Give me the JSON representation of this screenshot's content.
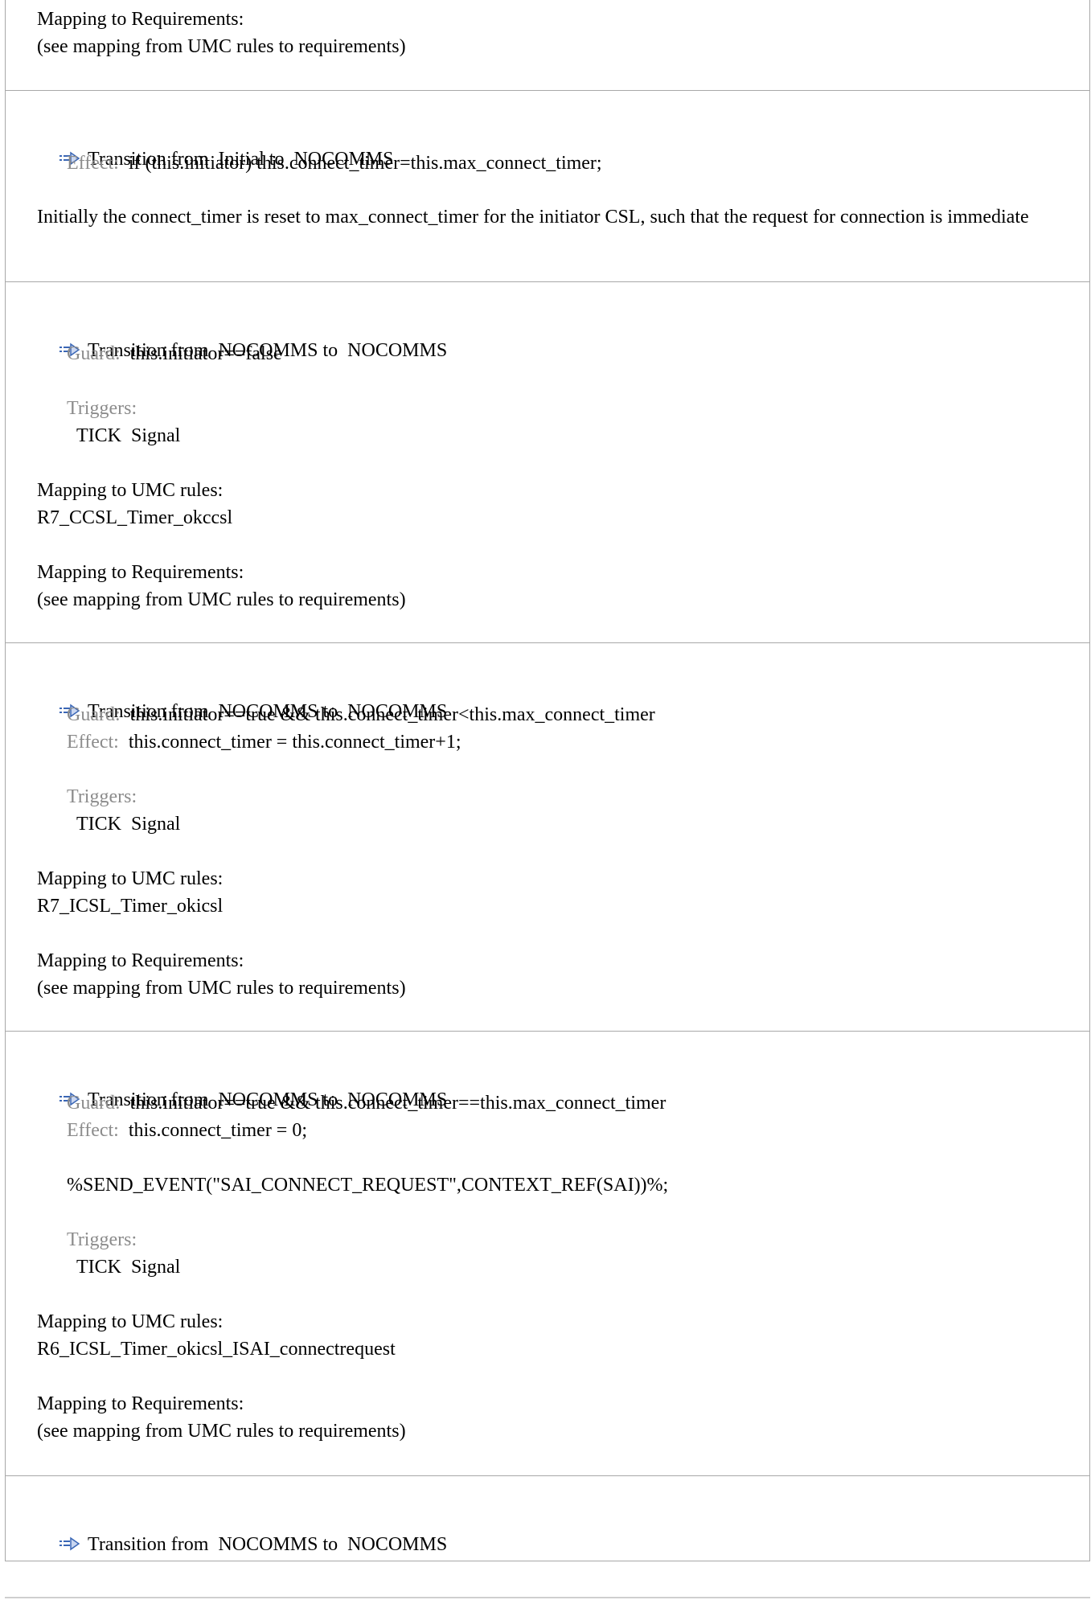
{
  "sections": [
    {
      "mapping_req_label": "Mapping to Requirements:",
      "mapping_req_value": "(see mapping from UMC rules to requirements)"
    },
    {
      "title": "Transition from  Initial to  NOCOMMS",
      "effect_label": "Effect:",
      "effect_value": "if (this.initiator) this.connect_timer=this.max_connect_timer;",
      "description": "Initially the connect_timer is reset to max_connect_timer for the initiator CSL, such that the request for connection is immediate"
    },
    {
      "title": "Transition from  NOCOMMS to  NOCOMMS",
      "guard_label": "Guard:",
      "guard_value": "this.initiator==false",
      "triggers_label": "Triggers:",
      "trigger_value": "TICK  Signal",
      "mapping_umc_label": "Mapping to UMC rules:",
      "mapping_umc_value": "R7_CCSL_Timer_okccsl",
      "mapping_req_label": "Mapping to Requirements:",
      "mapping_req_value": "(see mapping from UMC rules to requirements)"
    },
    {
      "title": "Transition from  NOCOMMS to  NOCOMMS",
      "guard_label": "Guard:",
      "guard_value": "this.initiator==true && this.connect_timer<this.max_connect_timer",
      "effect_label": "Effect:",
      "effect_value": "this.connect_timer = this.connect_timer+1;",
      "triggers_label": "Triggers:",
      "trigger_value": "TICK  Signal",
      "mapping_umc_label": "Mapping to UMC rules:",
      "mapping_umc_value": "R7_ICSL_Timer_okicsl",
      "mapping_req_label": "Mapping to Requirements:",
      "mapping_req_value": "(see mapping from UMC rules to requirements)"
    },
    {
      "title": "Transition from  NOCOMMS to  NOCOMMS",
      "guard_label": "Guard:",
      "guard_value": "this.initiator==true && this.connect_timer==this.max_connect_timer",
      "effect_label": "Effect:",
      "effect_value": "this.connect_timer = 0;",
      "effect_extra": "%SEND_EVENT(\"SAI_CONNECT_REQUEST\",CONTEXT_REF(SAI))%;",
      "triggers_label": "Triggers:",
      "trigger_value": "TICK  Signal",
      "mapping_umc_label": "Mapping to UMC rules:",
      "mapping_umc_value": "R6_ICSL_Timer_okicsl_ISAI_connectrequest",
      "mapping_req_label": "Mapping to Requirements:",
      "mapping_req_value": "(see mapping from UMC rules to requirements)"
    },
    {
      "title": "Transition from  NOCOMMS to  NOCOMMS"
    }
  ],
  "icon_name": "transition-arrow-icon",
  "colors": {
    "label_gray": "#8c8c8c",
    "border": "#a8a8a8",
    "icon_blue": "#3a66b5"
  }
}
